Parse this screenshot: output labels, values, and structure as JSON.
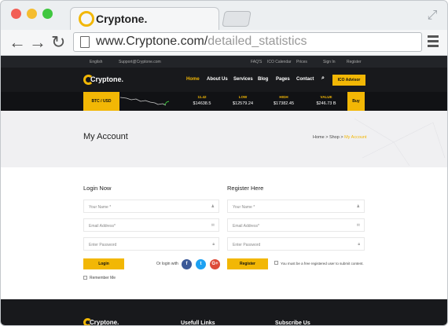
{
  "browser": {
    "tab_title": "Cryptone.",
    "url_domain": "www.Cryptone.com/",
    "url_path": "detailed_statistics",
    "colors": {
      "close": "#f25f56",
      "minimize": "#f5bd2f",
      "maximize": "#3fc73f"
    }
  },
  "topbar": {
    "language": "English",
    "email": "Support@Cryptone.com",
    "links": [
      "FAQ'S",
      "ICO Calendar",
      "Prices"
    ],
    "sign_in": "Sign In",
    "register": "Register"
  },
  "header": {
    "brand": "Cryptone.",
    "nav": [
      "Home",
      "About Us",
      "Services",
      "Blog",
      "Pages",
      "Contact"
    ],
    "active_nav": "Home",
    "cta": "ICO Advisor",
    "accent": "#f2b705"
  },
  "ticker": {
    "pair": "BTC / USD",
    "change_label": "11.42",
    "price": "$14638.5",
    "low_label": "LOW",
    "low": "$12579.24",
    "high_label": "HIGH",
    "high": "$17382.45",
    "value_label": "VALUE",
    "value": "$246.73 B",
    "buy": "Buy"
  },
  "banner": {
    "title": "My Account",
    "breadcrumb": [
      "Home",
      "Shop",
      "My Account"
    ]
  },
  "login": {
    "heading": "Login Now",
    "name_placeholder": "Your Name *",
    "email_placeholder": "Email Address*",
    "password_placeholder": "Enter Password",
    "button": "Login",
    "or_label": "Or login with",
    "remember": "Remember Me"
  },
  "register": {
    "heading": "Register Here",
    "name_placeholder": "Your Name *",
    "email_placeholder": "Email Address*",
    "password_placeholder": "Enter Password",
    "button": "Register",
    "note": "You must be a free registered user to submit content."
  },
  "footer": {
    "brand": "Cryptone.",
    "useful_links": "Usefull Links",
    "subscribe": "Subscribe Us"
  }
}
